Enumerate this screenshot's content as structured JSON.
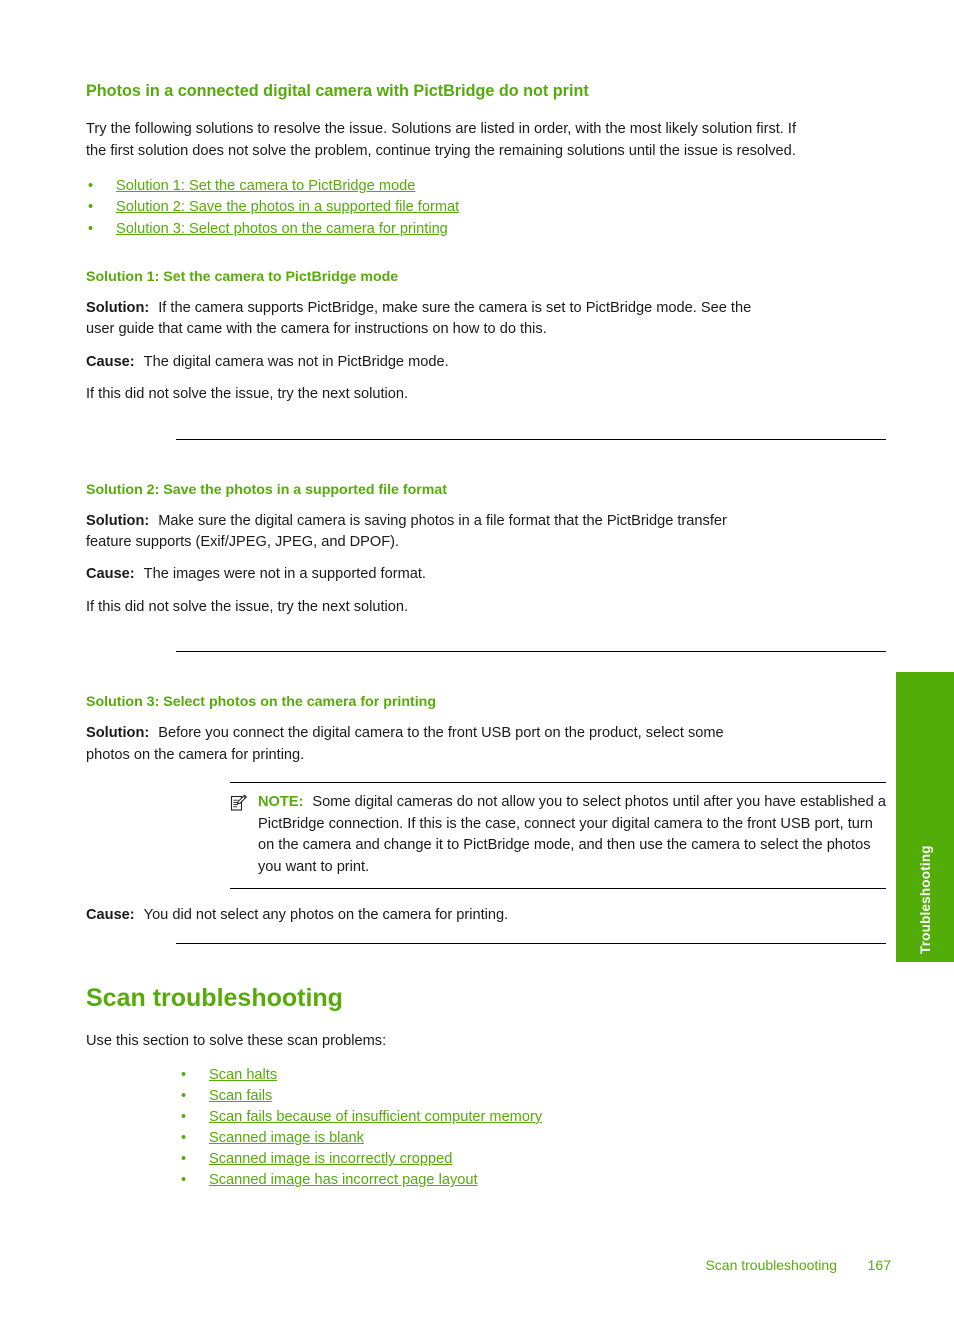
{
  "colors": {
    "accent_green": "#56ab0a",
    "tab_green": "#52ad08",
    "body_text": "#1a1a1a"
  },
  "side_tab": {
    "label": "Troubleshooting"
  },
  "topic": {
    "title": "Photos in a connected digital camera with PictBridge do not print",
    "intro": "Try the following solutions to resolve the issue. Solutions are listed in order, with the most likely solution first. If the first solution does not solve the problem, continue trying the remaining solutions until the issue is resolved.",
    "links": [
      {
        "bullet": "•",
        "text": "Solution 1: Set the camera to PictBridge mode"
      },
      {
        "bullet": "•",
        "text": "Solution 2: Save the photos in a supported file format"
      },
      {
        "bullet": "•",
        "text": "Solution 3: Select photos on the camera for printing"
      }
    ]
  },
  "solution1": {
    "title": "Solution 1: Set the camera to PictBridge mode",
    "solution_label": "Solution:",
    "solution_text": "If the camera supports PictBridge, make sure the camera is set to PictBridge mode. See the user guide that came with the camera for instructions on how to do this.",
    "cause_label": "Cause:",
    "cause_text": "The digital camera was not in PictBridge mode.",
    "next": "If this did not solve the issue, try the next solution."
  },
  "solution2": {
    "title": "Solution 2: Save the photos in a supported file format",
    "solution_label": "Solution:",
    "solution_text": "Make sure the digital camera is saving photos in a file format that the PictBridge transfer feature supports (Exif/JPEG, JPEG, and DPOF).",
    "cause_label": "Cause:",
    "cause_text": "The images were not in a supported format.",
    "next": "If this did not solve the issue, try the next solution."
  },
  "solution3": {
    "title": "Solution 3: Select photos on the camera for printing",
    "solution_label": "Solution:",
    "solution_text": "Before you connect the digital camera to the front USB port on the product, select some photos on the camera for printing.",
    "note_label": "NOTE:",
    "note_text": "Some digital cameras do not allow you to select photos until after you have established a PictBridge connection. If this is the case, connect your digital camera to the front USB port, turn on the camera and change it to PictBridge mode, and then use the camera to select the photos you want to print.",
    "cause_label": "Cause:",
    "cause_text": "You did not select any photos on the camera for printing."
  },
  "scan_section": {
    "title": "Scan troubleshooting",
    "intro": "Use this section to solve these scan problems:",
    "links": [
      {
        "bullet": "•",
        "text": "Scan halts"
      },
      {
        "bullet": "•",
        "text": "Scan fails"
      },
      {
        "bullet": "•",
        "text": "Scan fails because of insufficient computer memory"
      },
      {
        "bullet": "•",
        "text": "Scanned image is blank"
      },
      {
        "bullet": "•",
        "text": "Scanned image is incorrectly cropped"
      },
      {
        "bullet": "•",
        "text": "Scanned image has incorrect page layout"
      }
    ]
  },
  "footer": {
    "running_head": "Scan troubleshooting",
    "page_number": "167"
  }
}
